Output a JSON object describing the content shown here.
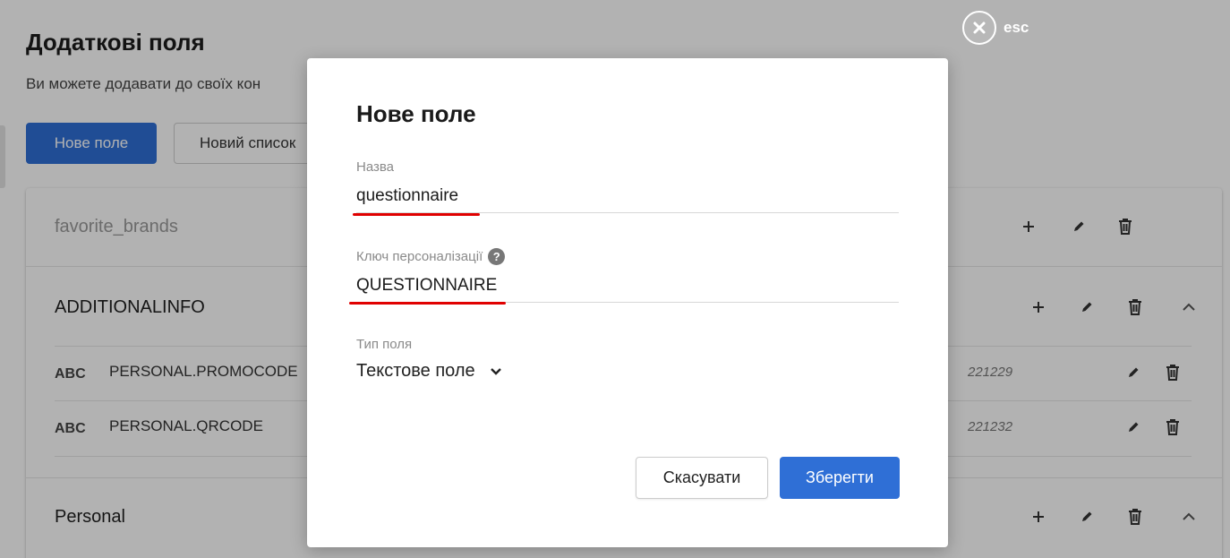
{
  "page": {
    "title": "Додаткові поля",
    "description": "Ви можете додавати до своїх кон",
    "new_field_button": "Нове поле",
    "new_list_button": "Новий список"
  },
  "lists": [
    {
      "name": "favorite_brands",
      "muted": true,
      "fields": []
    },
    {
      "name": "ADDITIONALINFO",
      "fields": [
        {
          "type": "ABC",
          "name": "PERSONAL.PROMOCODE",
          "id": "221229"
        },
        {
          "type": "ABC",
          "name": "PERSONAL.QRCODE",
          "id": "221232"
        }
      ]
    },
    {
      "name": "Personal",
      "fields": []
    }
  ],
  "close": {
    "label": "esc",
    "icon": "close-icon"
  },
  "modal": {
    "title": "Нове поле",
    "name_label": "Назва",
    "name_value": "questionnaire",
    "key_label": "Ключ персоналізації",
    "key_help_icon": "?",
    "key_value": "QUESTIONNAIRE",
    "type_label": "Тип поля",
    "type_value": "Текстове поле",
    "cancel_button": "Скасувати",
    "save_button": "Зберегти"
  },
  "colors": {
    "primary": "#2f6fd6",
    "highlight_underline": "#e00000",
    "overlay": "rgba(0,0,0,0.30)"
  }
}
